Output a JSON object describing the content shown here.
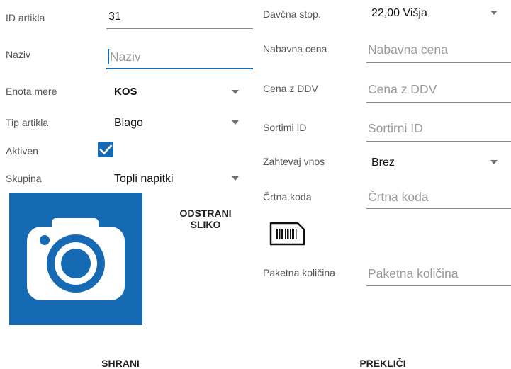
{
  "left": {
    "id": {
      "label": "ID artikla",
      "value": "31"
    },
    "name": {
      "label": "Naziv",
      "placeholder": "Naziv"
    },
    "unit": {
      "label": "Enota mere",
      "value": "KOS"
    },
    "type": {
      "label": "Tip artikla",
      "value": "Blago"
    },
    "active": {
      "label": "Aktiven",
      "checked": true
    },
    "group": {
      "label": "Skupina",
      "value": "Topli napitki"
    }
  },
  "image": {
    "remove_label_line1": "ODSTRANI",
    "remove_label_line2": "SLIKO",
    "icon": "camera-icon",
    "bg_color": "#1669b3"
  },
  "right": {
    "tax": {
      "label": "Davčna stop.",
      "value": "22,00 Višja"
    },
    "purchase": {
      "label": "Nabavna cena",
      "placeholder": "Nabavna cena"
    },
    "price": {
      "label": "Cena z DDV",
      "placeholder": "Cena z DDV"
    },
    "sort": {
      "label": "Sortimi ID",
      "placeholder": "Sortirni ID"
    },
    "require": {
      "label": "Zahtevaj vnos",
      "value": "Brez"
    },
    "barcode": {
      "label": "Črtna koda",
      "placeholder": "Črtna koda",
      "icon": "barcode-icon"
    },
    "package": {
      "label": "Paketna količina",
      "placeholder": "Paketna količina"
    }
  },
  "actions": {
    "save": "SHRANI",
    "cancel": "PREKLIČI"
  },
  "colors": {
    "accent": "#1669b3"
  }
}
